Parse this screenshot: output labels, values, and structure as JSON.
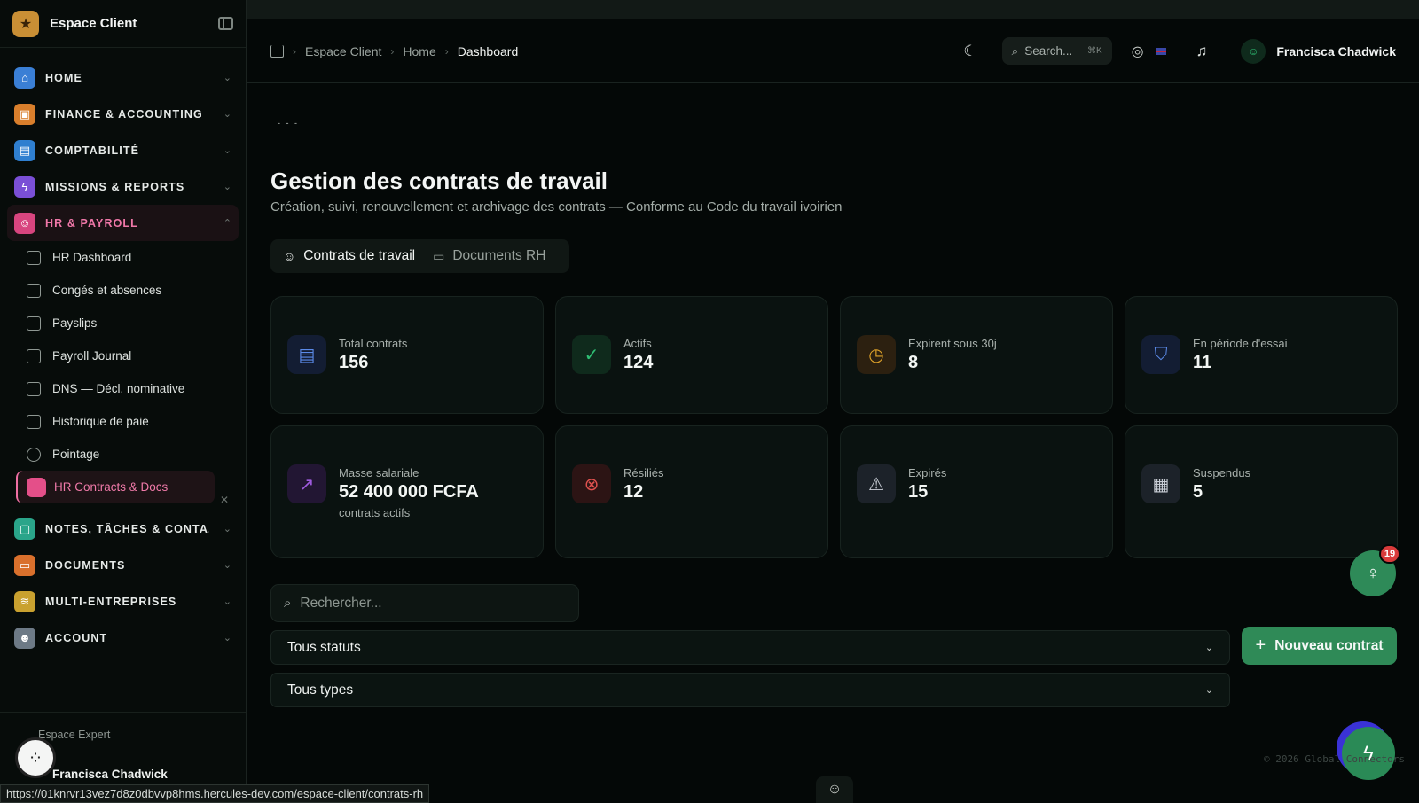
{
  "sidebar": {
    "brand": "Espace Client",
    "items": [
      {
        "label": "HOME",
        "color": "#3a7fd5"
      },
      {
        "label": "FINANCE & ACCOUNTING",
        "color": "#d97f2c"
      },
      {
        "label": "COMPTABILITÉ",
        "color": "#2f7fd0"
      },
      {
        "label": "MISSIONS & REPORTS",
        "color": "#7a4fd6"
      },
      {
        "label": "HR & PAYROLL",
        "color": "#d8457f"
      },
      {
        "label": "NOTES, TÂCHES & CONTA...",
        "color": "#2aa58a"
      },
      {
        "label": "DOCUMENTS",
        "color": "#d9702c"
      },
      {
        "label": "MULTI-ENTREPRISES",
        "color": "#c9a12f"
      },
      {
        "label": "ACCOUNT",
        "color": "#6d7a86"
      }
    ],
    "sub_items": [
      "HR Dashboard",
      "Congés et absences",
      "Payslips",
      "Payroll Journal",
      "DNS — Décl. nominative",
      "Historique de paie",
      "Pointage",
      "HR Contracts & Docs"
    ],
    "footer": {
      "back_label": "Espace Expert",
      "user_name": "Francisca Chadwick"
    }
  },
  "topbar": {
    "breadcrumb": [
      "Espace Client",
      "Home",
      "Dashboard"
    ],
    "search_placeholder": "Search...",
    "search_shortcut": "⌘K",
    "user_name": "Francisca Chadwick"
  },
  "main": {
    "dots": "- - -",
    "title": "Gestion des contrats de travail",
    "subtitle": "Création, suivi, renouvellement et archivage des contrats — Conforme au Code du travail ivoirien",
    "tabs": [
      "Contrats de travail",
      "Documents RH"
    ],
    "cards": [
      {
        "label": "Total contrats",
        "value": "156",
        "icon": "document-icon",
        "color": "#4f7fe0"
      },
      {
        "label": "Actifs",
        "value": "124",
        "icon": "check-circle-icon",
        "color": "#2fbf74"
      },
      {
        "label": "Expirent sous 30j",
        "value": "8",
        "icon": "clock-icon",
        "color": "#e0a32a"
      },
      {
        "label": "En période d'essai",
        "value": "11",
        "icon": "shield-icon",
        "color": "#4f7fe0"
      },
      {
        "label": "Masse salariale",
        "value": "52 400 000 FCFA",
        "note": "contrats actifs",
        "icon": "trending-up-icon",
        "color": "#a05be0"
      },
      {
        "label": "Résiliés",
        "value": "12",
        "icon": "x-circle-icon",
        "color": "#e0524f"
      },
      {
        "label": "Expirés",
        "value": "15",
        "icon": "warning-icon",
        "color": "#c9ced6"
      },
      {
        "label": "Suspendus",
        "value": "5",
        "icon": "briefcase-icon",
        "color": "#c9ced6"
      }
    ],
    "search_placeholder": "Rechercher...",
    "filter_status": "Tous statuts",
    "filter_type": "Tous types",
    "new_button": "Nouveau contrat"
  },
  "floating": {
    "notif_count": "19",
    "copyright": "© 2026 Global Connectors"
  },
  "status_url": "https://01knrvr13vez7d8z0dbvvp8hms.hercules-dev.com/espace-client/contrats-rh"
}
